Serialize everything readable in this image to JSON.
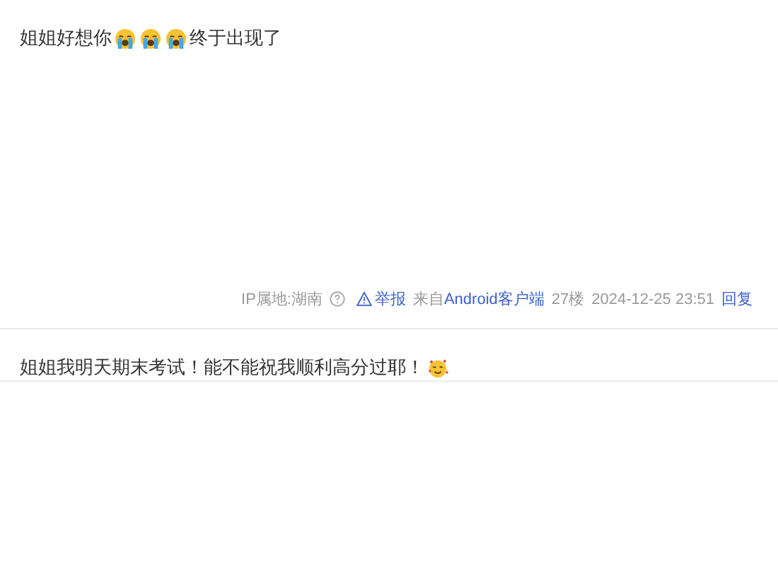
{
  "posts": [
    {
      "content": [
        {
          "kind": "text",
          "text": "姐姐好想你"
        },
        {
          "kind": "sob"
        },
        {
          "kind": "sob"
        },
        {
          "kind": "sob"
        },
        {
          "kind": "text",
          "text": "终于出现了"
        }
      ],
      "footer": {
        "ip_location": "IP属地:湖南",
        "report": "举报",
        "source_prefix": "来自",
        "source_link": "Android客户端",
        "floor": "27楼",
        "time": "2024-12-25 23:51",
        "reply": "回复"
      }
    },
    {
      "content": [
        {
          "kind": "text",
          "text": "姐姐我明天期末考试！能不能祝我顺利高分过耶！"
        },
        {
          "kind": "adoring"
        }
      ]
    }
  ]
}
